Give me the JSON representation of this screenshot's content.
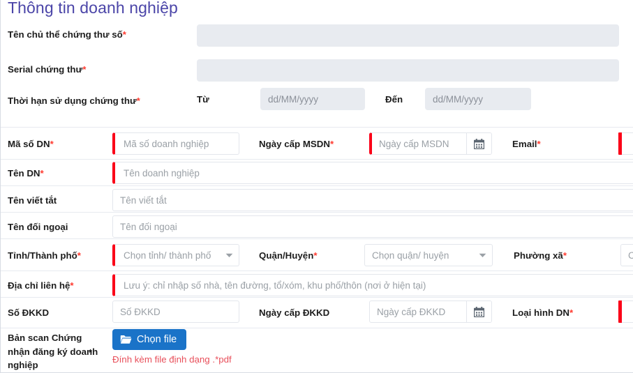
{
  "title": "Thông tin doanh nghiệp",
  "accent_color": "#4b45a8",
  "required_marker_color": "#fb0018",
  "button_color": "#1a73c8",
  "hint_color": "#e8505b",
  "rows": {
    "cert_subject": {
      "label": "Tên chủ thể chứng thư số",
      "required": "*",
      "value": ""
    },
    "cert_serial": {
      "label": "Serial chứng thư",
      "required": "*",
      "value": ""
    },
    "cert_validity": {
      "label": "Thời hạn sử dụng chứng thư",
      "required": "*",
      "from_label": "Từ",
      "from_placeholder": "dd/MM/yyyy",
      "to_label": "Đến",
      "to_placeholder": "dd/MM/yyyy"
    },
    "business_code": {
      "label": "Mã số DN",
      "required": "*",
      "placeholder": "Mã số doanh nghiệp"
    },
    "msdn_date": {
      "label": "Ngày cấp MSDN",
      "required": "*",
      "placeholder": "Ngày cấp MSDN",
      "icon": "calendar-icon"
    },
    "email": {
      "label": "Email",
      "required": "*",
      "placeholder": ""
    },
    "business_name": {
      "label": "Tên DN",
      "required": "*",
      "placeholder": "Tên doanh nghiệp"
    },
    "short_name": {
      "label": "Tên viết tắt",
      "required": "",
      "placeholder": "Tên viết tắt"
    },
    "foreign_name": {
      "label": "Tên đối ngoại",
      "required": "",
      "placeholder": "Tên đối ngoại"
    },
    "province": {
      "label": "Tỉnh/Thành phố",
      "required": "*",
      "placeholder": "Chọn tỉnh/ thành phố"
    },
    "district": {
      "label": "Quận/Huyện",
      "required": "*",
      "placeholder": "Chọn quận/ huyện"
    },
    "ward": {
      "label": "Phường xã",
      "required": "*",
      "placeholder": "C"
    },
    "address": {
      "label": "Địa chỉ liên hệ",
      "required": "*",
      "placeholder": "Lưu ý: chỉ nhập số nhà, tên đường, tổ/xóm, khu phố/thôn (nơi ở hiện tại)"
    },
    "dkkd_number": {
      "label": "Số ĐKKD",
      "required": "",
      "placeholder": "Số ĐKKD"
    },
    "dkkd_date": {
      "label": "Ngày cấp ĐKKD",
      "required": "",
      "placeholder": "Ngày cấp ĐKKD",
      "icon": "calendar-icon"
    },
    "business_type": {
      "label": "Loại hình DN",
      "required": "*",
      "placeholder": ""
    },
    "scan_file": {
      "label": "Bản scan Chứng nhận đăng ký doanh nghiệp",
      "required": "*",
      "button_label": "Chọn file",
      "button_icon": "folder-icon",
      "hint": "Đính kèm file định dạng .*pdf"
    }
  }
}
